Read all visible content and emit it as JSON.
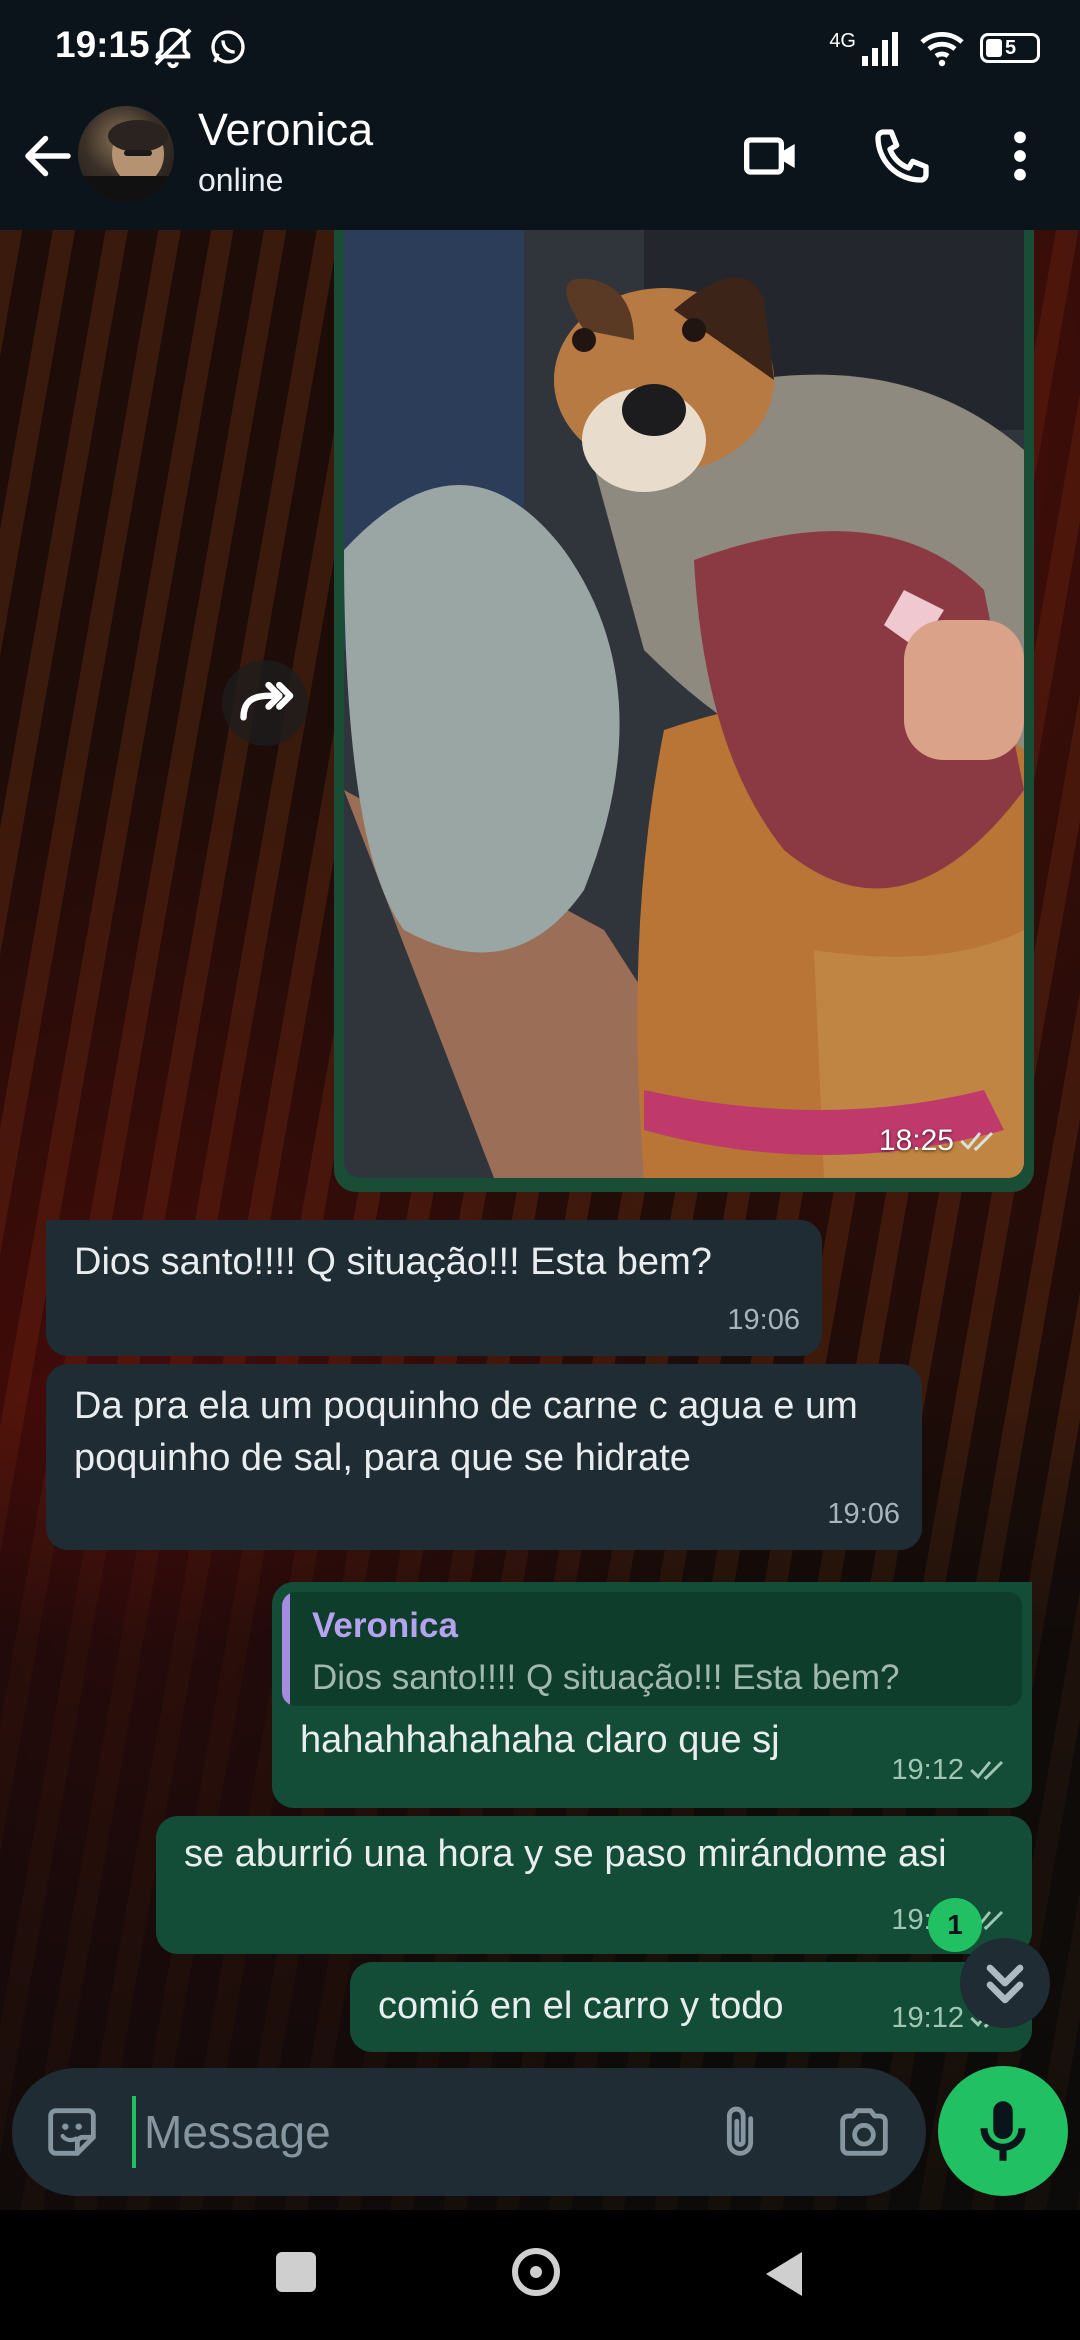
{
  "status_bar": {
    "time": "19:15",
    "network": "4G",
    "battery": "5"
  },
  "header": {
    "contact_name": "Veronica",
    "contact_status": "online"
  },
  "image_message": {
    "time": "18:25",
    "status": "read"
  },
  "messages": [
    {
      "direction": "in",
      "text": "Dios santo!!!! Q situação!!! Esta bem?",
      "time": "19:06"
    },
    {
      "direction": "in",
      "text": "Da pra ela um poquinho de carne c agua e um poquinho de sal, para que se hidrate",
      "time": "19:06"
    },
    {
      "direction": "out",
      "quote": {
        "author": "Veronica",
        "text": "Dios santo!!!! Q situação!!! Esta bem?"
      },
      "text": "hahahhahahaha claro que sj",
      "time": "19:12"
    },
    {
      "direction": "out",
      "text": "se aburrió una hora y se paso mirándome asi",
      "time": "19:12"
    },
    {
      "direction": "out",
      "text": "comió en el carro y todo",
      "time": "19:12"
    }
  ],
  "unread_count": "1",
  "input": {
    "placeholder": "Message",
    "value": ""
  },
  "colors": {
    "outgoing_bubble": "#144d37",
    "incoming_bubble": "#202c33",
    "accent": "#21c063",
    "header_bg": "#0b141a"
  },
  "icons": {
    "back": "arrow-left-icon",
    "video": "video-camera-icon",
    "call": "phone-icon",
    "menu": "more-vertical-icon",
    "forward": "forward-icon",
    "scroll": "double-chevron-down-icon",
    "sticker": "sticker-icon",
    "attach": "paperclip-icon",
    "camera": "camera-icon",
    "mic": "microphone-icon"
  }
}
